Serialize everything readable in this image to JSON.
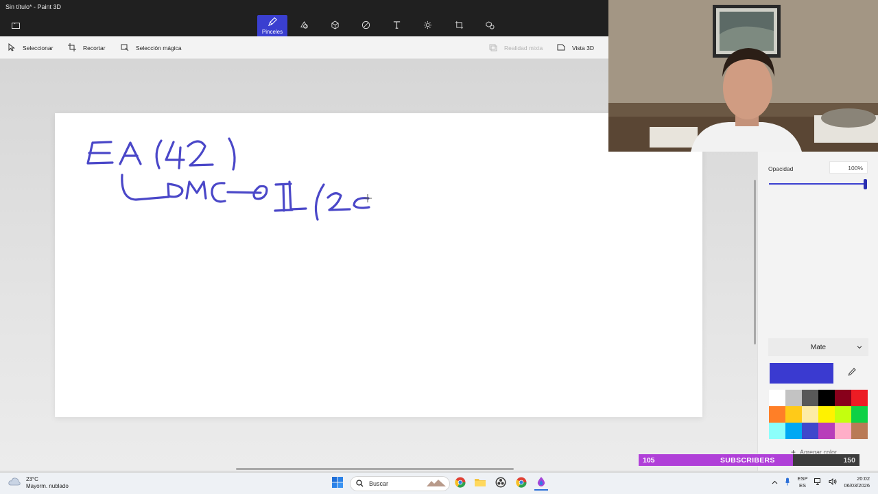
{
  "window": {
    "title": "Sin título* - Paint 3D"
  },
  "toolbar": {
    "tools": [
      {
        "name": "Pinceles",
        "icon": "brush-icon",
        "active": true
      }
    ]
  },
  "subbar": {
    "select": "Seleccionar",
    "crop": "Recortar",
    "magic_select": "Selección mágica",
    "mixed_reality": "Realidad mixta",
    "view3d": "Vista 3D"
  },
  "canvas": {
    "drawing_color": "#4a47c8",
    "handwriting_text": "EA(42) → DMC → IL(2c"
  },
  "panel": {
    "opacity_label": "Opacidad",
    "opacity_value": "100%",
    "opacity_percent": 100,
    "finish": "Mate",
    "current_color": "#3a3ad0",
    "add_color": "Agregar color",
    "swatches": [
      "#ffffff",
      "#c3c3c3",
      "#585858",
      "#000000",
      "#88001b",
      "#ec1c24",
      "#ff7f27",
      "#ffca18",
      "#fdeca6",
      "#fff200",
      "#c4ff0e",
      "#0ed145",
      "#8cfffb",
      "#00a8f3",
      "#3f48cc",
      "#b83dba",
      "#ffaec8",
      "#b97a56"
    ]
  },
  "subscribers": {
    "current": "105",
    "label": "SUBSCRIBERS",
    "goal": "150",
    "fill_fraction": 0.7
  },
  "taskbar": {
    "weather_temp": "23°C",
    "weather_desc": "Mayorm. nublado",
    "search_placeholder": "Buscar",
    "lang_top": "ESP",
    "lang_bottom": "ES",
    "time": "20:02",
    "date": "06/03/2026"
  }
}
